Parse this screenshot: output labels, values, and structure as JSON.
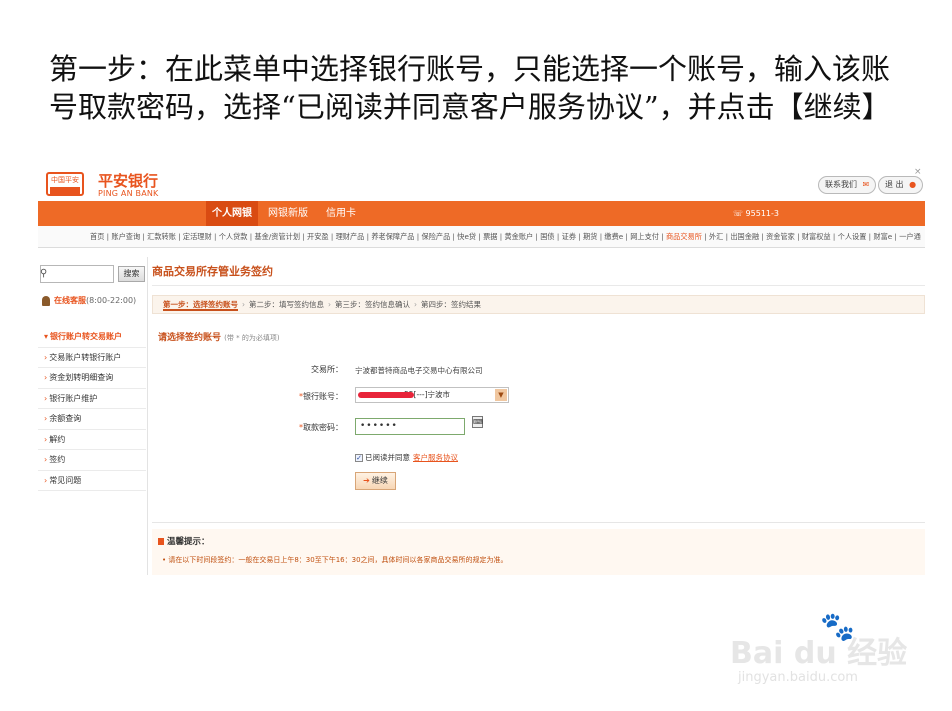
{
  "slide": {
    "instruction": "第一步：在此菜单中选择银行账号，只能选择一个账号，输入该账号取款密码，选择“已阅读并同意客户服务协议”，并点击【继续】"
  },
  "header": {
    "logo_text": "中国平安",
    "brand_cn": "平安银行",
    "brand_en": "PING AN BANK",
    "contact_label": "联系我们",
    "logout_label": "退 出",
    "close_glyph": "×",
    "colors": {
      "accent": "#ee6a26",
      "active_tab": "#d94b12"
    }
  },
  "nav": {
    "tabs": [
      "个人网银",
      "网银新版",
      "信用卡"
    ],
    "hotline": "95511-3"
  },
  "subnav": {
    "items": [
      "首页",
      "账户查询",
      "汇款转账",
      "定活理财",
      "个人贷款",
      "基金/资管计划",
      "开安盈",
      "理财产品",
      "养老保障产品",
      "保险产品",
      "快e贷",
      "票据",
      "黄金账户",
      "国债",
      "证券",
      "期货",
      "缴费e",
      "网上支付",
      "商品交易所",
      "外汇",
      "出国金融",
      "资金管家",
      "财富权益",
      "个人设置",
      "财富e",
      "一户通"
    ],
    "highlight": "商品交易所"
  },
  "sidebar": {
    "search_placeholder": "",
    "search_button": "搜索",
    "service_label": "在线客服",
    "service_hours": "(8:00-22:00)",
    "items": [
      {
        "label": "银行账户转交易账户",
        "active": true
      },
      {
        "label": "交易账户转银行账户",
        "active": false
      },
      {
        "label": "资金划转明细查询",
        "active": false
      },
      {
        "label": "银行账户维护",
        "active": false
      },
      {
        "label": "余额查询",
        "active": false
      },
      {
        "label": "解约",
        "active": false
      },
      {
        "label": "签约",
        "active": false
      },
      {
        "label": "常见问题",
        "active": false
      }
    ]
  },
  "main": {
    "title": "商品交易所存管业务签约",
    "steps": [
      "第一步：选择签约账号",
      "第二步：填写签约信息",
      "第三步：签约信息确认",
      "第四步：签约结果"
    ],
    "section_title": "请选择签约账号",
    "section_note": "(带 * 的为必填项)",
    "exchange_label": "交易所：",
    "exchange_value": "宁波都普特商品电子交易中心有限公司",
    "account_label": "银行账号：",
    "account_value": "55[---]宁波市",
    "password_label": "取款密码：",
    "password_value": "••••••",
    "agree_text": "已阅读并同意",
    "agree_link": "客户服务协议",
    "continue_label": "继续",
    "tips_title": "温馨提示：",
    "tips_text": "请在以下时间段签约：一般在交易日上午8：30至下午16：30之间，具体时间以各家商品交易所的规定为准。"
  },
  "watermark": {
    "brand": "Bai du 经验",
    "url": "jingyan.baidu.com"
  }
}
